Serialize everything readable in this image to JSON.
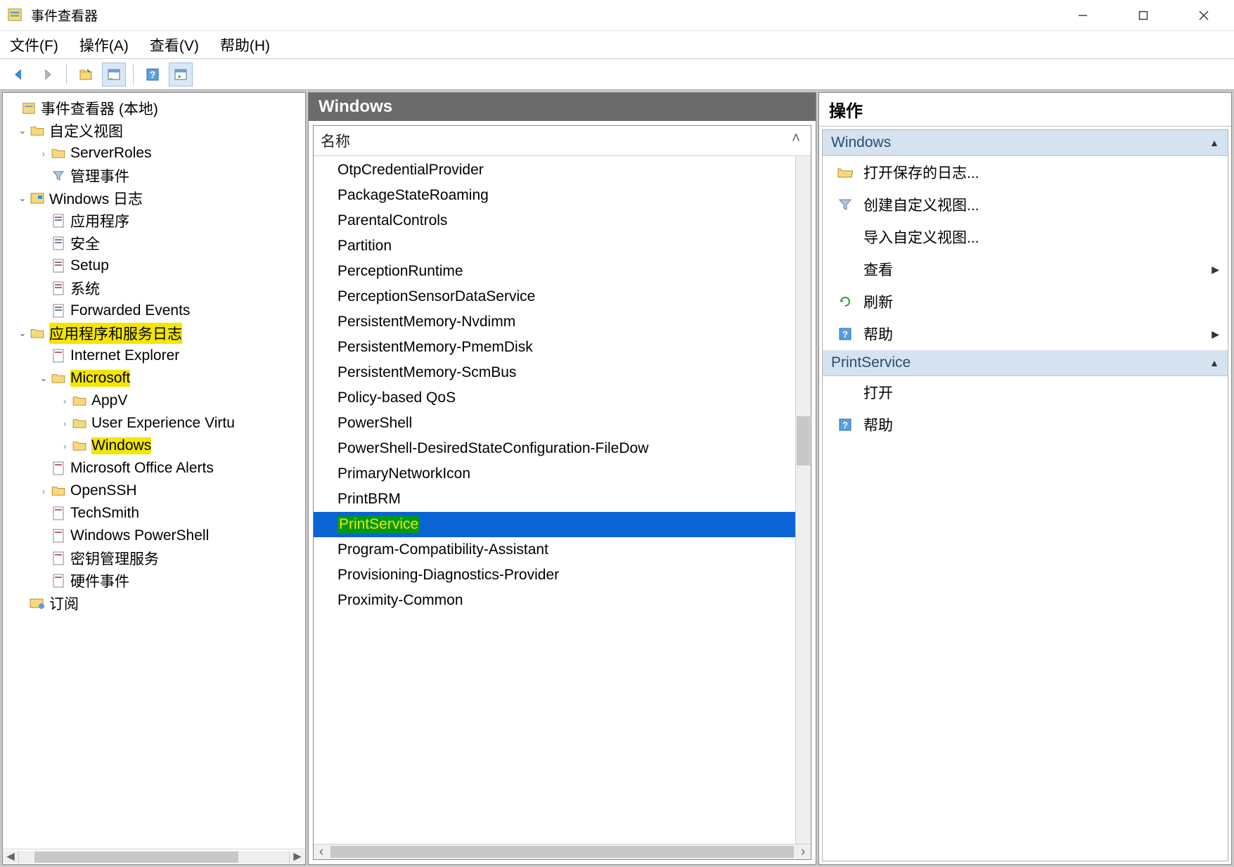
{
  "window": {
    "title": "事件查看器"
  },
  "menubar": {
    "file": "文件(F)",
    "action": "操作(A)",
    "view": "查看(V)",
    "help": "帮助(H)"
  },
  "tree": {
    "root": "事件查看器 (本地)",
    "custom_views": "自定义视图",
    "server_roles": "ServerRoles",
    "admin_events": "管理事件",
    "windows_logs": "Windows 日志",
    "app_log": "应用程序",
    "security_log": "安全",
    "setup_log": "Setup",
    "system_log": "系统",
    "fwd_events": "Forwarded Events",
    "apps_services": "应用程序和服务日志",
    "ie": "Internet Explorer",
    "microsoft": "Microsoft",
    "appv": "AppV",
    "uev": "User Experience Virtu",
    "windows_sub": "Windows",
    "office_alerts": "Microsoft Office Alerts",
    "openssh": "OpenSSH",
    "techsmith": "TechSmith",
    "win_ps": "Windows PowerShell",
    "key_mgmt": "密钥管理服务",
    "hw_events": "硬件事件",
    "subscriptions": "订阅"
  },
  "center": {
    "header": "Windows",
    "col_name": "名称",
    "items": [
      "OtpCredentialProvider",
      "PackageStateRoaming",
      "ParentalControls",
      "Partition",
      "PerceptionRuntime",
      "PerceptionSensorDataService",
      "PersistentMemory-Nvdimm",
      "PersistentMemory-PmemDisk",
      "PersistentMemory-ScmBus",
      "Policy-based QoS",
      "PowerShell",
      "PowerShell-DesiredStateConfiguration-FileDow",
      "PrimaryNetworkIcon",
      "PrintBRM",
      "PrintService",
      "Program-Compatibility-Assistant",
      "Provisioning-Diagnostics-Provider",
      "Proximity-Common"
    ],
    "selected": "PrintService"
  },
  "actions": {
    "title": "操作",
    "section1": "Windows",
    "open_saved_log": "打开保存的日志...",
    "create_custom_view": "创建自定义视图...",
    "import_custom_view": "导入自定义视图...",
    "view": "查看",
    "refresh": "刷新",
    "help": "帮助",
    "section2": "PrintService",
    "open": "打开",
    "help2": "帮助"
  }
}
